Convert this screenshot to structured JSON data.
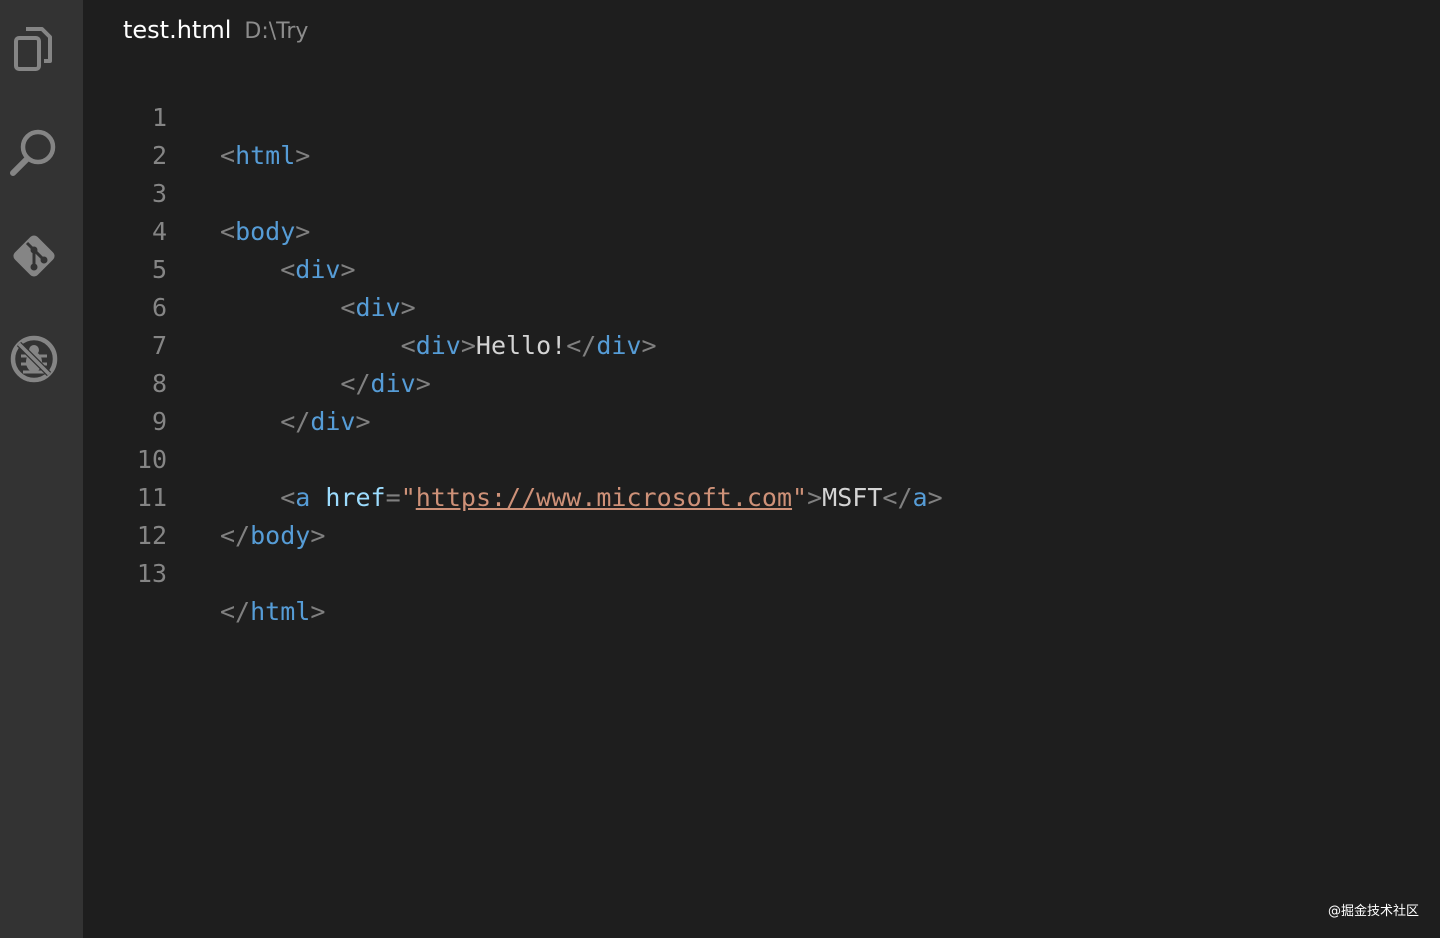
{
  "activity_bar": {
    "icons": [
      "files-icon",
      "search-icon",
      "source-control-icon",
      "debug-icon"
    ]
  },
  "editor": {
    "file_name": "test.html",
    "file_path": "D:\\Try"
  },
  "code": {
    "line_numbers": [
      "1",
      "2",
      "3",
      "4",
      "5",
      "6",
      "7",
      "8",
      "9",
      "10",
      "11",
      "12",
      "13"
    ],
    "lines": {
      "l1": {
        "open": "<",
        "tag": "html",
        "close": ">"
      },
      "l3": {
        "open": "<",
        "tag": "body",
        "close": ">"
      },
      "l4": {
        "indent": "    ",
        "open": "<",
        "tag": "div",
        "close": ">"
      },
      "l5": {
        "indent": "        ",
        "open": "<",
        "tag": "div",
        "close": ">"
      },
      "l6": {
        "indent": "            ",
        "open": "<",
        "tag": "div",
        "close": ">",
        "text": "Hello!",
        "end_open": "</",
        "end_tag": "div",
        "end_close": ">"
      },
      "l7": {
        "indent": "        ",
        "open": "</",
        "tag": "div",
        "close": ">"
      },
      "l8": {
        "indent": "    ",
        "open": "</",
        "tag": "div",
        "close": ">"
      },
      "l10": {
        "indent": "    ",
        "open": "<",
        "tag": "a",
        "space": " ",
        "attr": "href",
        "eq": "=",
        "quote": "\"",
        "url": "https://www.microsoft.com",
        "quote_end": "\"",
        "close": ">",
        "text": "MSFT",
        "end_open": "</",
        "end_tag": "a",
        "end_close": ">"
      },
      "l11": {
        "open": "</",
        "tag": "body",
        "close": ">"
      },
      "l13": {
        "open": "</",
        "tag": "html",
        "close": ">"
      }
    }
  },
  "watermark": "@掘金技术社区",
  "colors": {
    "background": "#1e1e1e",
    "activity_bar": "#333333",
    "tag": "#569cd6",
    "attribute": "#9cdcfe",
    "string": "#ce9178",
    "punctuation": "#808080",
    "text": "#d4d4d4",
    "line_number": "#858585"
  }
}
